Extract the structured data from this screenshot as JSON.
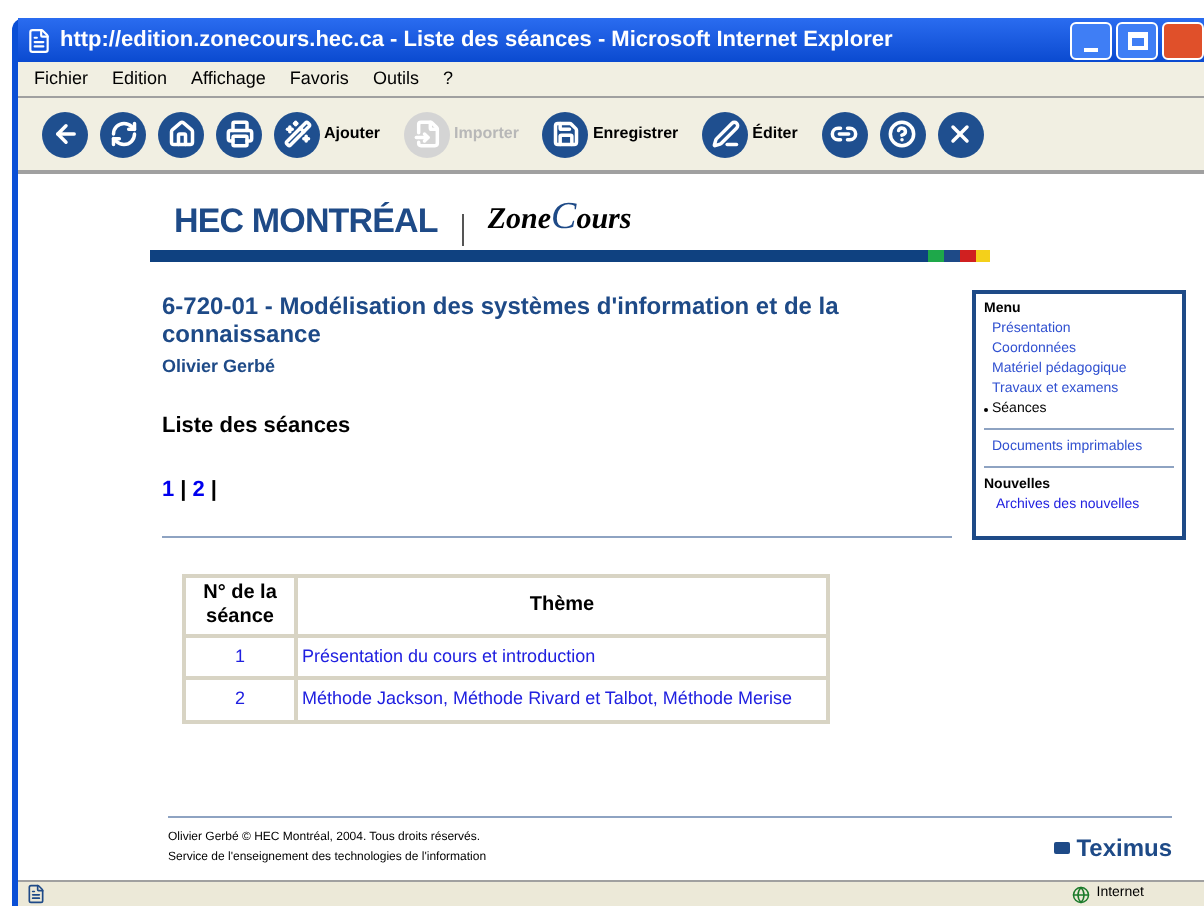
{
  "window": {
    "title": "http://edition.zonecours.hec.ca - Liste des séances - Microsoft Internet Explorer"
  },
  "menu_bar": [
    "Fichier",
    "Edition",
    "Affichage",
    "Favoris",
    "Outils",
    "?"
  ],
  "toolbar": [
    {
      "kind": "back",
      "disabled": false
    },
    {
      "kind": "refresh",
      "disabled": false
    },
    {
      "kind": "home",
      "disabled": false
    },
    {
      "kind": "print",
      "disabled": false
    },
    {
      "kind": "add",
      "label": "Ajouter",
      "disabled": false
    },
    {
      "kind": "import",
      "label": "Importer",
      "disabled": true
    },
    {
      "kind": "save",
      "label": "Enregistrer",
      "disabled": false
    },
    {
      "kind": "edit",
      "label": "Éditer",
      "disabled": false
    },
    {
      "kind": "link",
      "disabled": false
    },
    {
      "kind": "help",
      "disabled": false
    },
    {
      "kind": "close",
      "disabled": false
    }
  ],
  "header": {
    "logo": "HEC MONTRÉAL",
    "brand_start": "Zone",
    "brand_end": "Cours"
  },
  "course": {
    "title": "6-720-01 - Modélisation des systèmes d'information et de la connaissance",
    "author": "Olivier Gerbé",
    "section_title": "Liste des séances"
  },
  "pager": [
    {
      "label": "1",
      "separator": "|"
    },
    {
      "label": "2",
      "separator": "|"
    }
  ],
  "table": {
    "columns": [
      "N° de la séance",
      "Thème"
    ],
    "rows": [
      {
        "number": "1",
        "theme": "Présentation du cours et introduction"
      },
      {
        "number": "2",
        "theme": "Méthode Jackson, Méthode Rivard et Talbot, Méthode Merise"
      }
    ]
  },
  "side_menu": {
    "heading": "Menu",
    "items": [
      {
        "label": "Présentation",
        "selected": false
      },
      {
        "label": "Coordonnées",
        "selected": false
      },
      {
        "label": "Matériel pédagogique",
        "selected": false
      },
      {
        "label": "Travaux et examens",
        "selected": false
      },
      {
        "label": "Séances",
        "selected": true
      }
    ],
    "extra_link": "Documents imprimables",
    "news_heading": "Nouvelles",
    "news_link": "Archives des nouvelles"
  },
  "footer": {
    "lines": [
      "Olivier Gerbé © HEC Montréal, 2004. Tous droits réservés.",
      "Service de l'enseignement des technologies de l'information"
    ],
    "brand": "Teximus"
  },
  "status_bar": {
    "zone": "Internet"
  }
}
